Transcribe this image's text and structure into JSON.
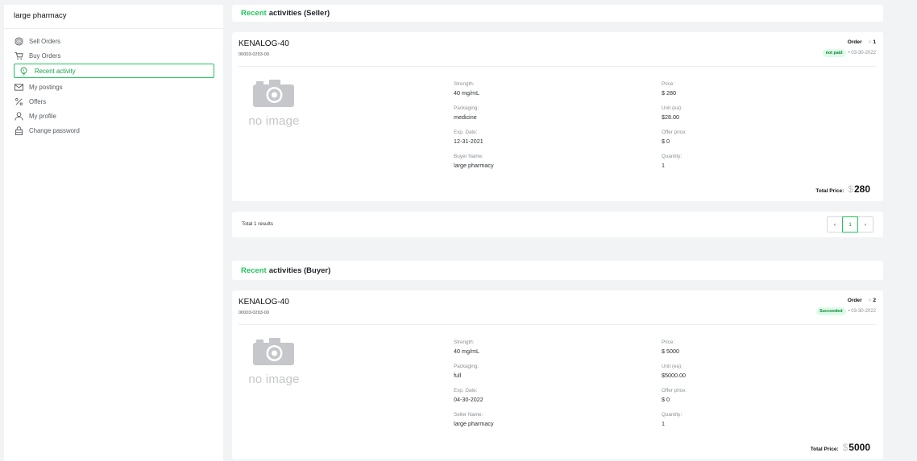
{
  "sidebar": {
    "title": "large pharmacy",
    "items": [
      {
        "label": "Sell Orders",
        "icon": "dollar-circle-icon"
      },
      {
        "label": "Buy Orders",
        "icon": "cart-icon"
      },
      {
        "label": "Recent activity",
        "icon": "lightbulb-icon",
        "active": true
      },
      {
        "label": "My postings",
        "icon": "mail-icon"
      },
      {
        "label": "Offers",
        "icon": "percent-icon"
      },
      {
        "label": "My profile",
        "icon": "user-icon"
      },
      {
        "label": "Change password",
        "icon": "lock-icon"
      }
    ]
  },
  "seller_section": {
    "title_highlight": "Recent",
    "title_rest": "activities (Seller)",
    "card": {
      "name": "KENALOG-40",
      "ndc": "00003-0293-00",
      "order_label": "Order",
      "order_hash": "#",
      "order_number": "1",
      "status": "not paid",
      "date": "• 03-30-2022",
      "no_image": "no image",
      "fields_left": [
        {
          "label": "Strength:",
          "value": "40 mg/mL"
        },
        {
          "label": "Packaging:",
          "value": "medicine"
        },
        {
          "label": "Exp. Date:",
          "value": "12-31-2021"
        },
        {
          "label": "Buyer Name:",
          "value": "large pharmacy"
        }
      ],
      "fields_right": [
        {
          "label": "Price:",
          "value": "$ 280"
        },
        {
          "label": "Unit (ea):",
          "value": "$28.00"
        },
        {
          "label": "Offer price:",
          "value": "$ 0"
        },
        {
          "label": "Quantity:",
          "value": "1"
        }
      ],
      "total_label": "Total Price:",
      "total_currency": "$",
      "total_amount": "280"
    },
    "pager": {
      "results_text": "Total 1 results",
      "prev": "‹",
      "page": "1",
      "next": "›"
    }
  },
  "buyer_section": {
    "title_highlight": "Recent",
    "title_rest": "activities (Buyer)",
    "card": {
      "name": "KENALOG-40",
      "ndc": "00003-0293-00",
      "order_label": "Order",
      "order_hash": "#",
      "order_number": "2",
      "status": "Succeeded",
      "date": "• 03-30-2022",
      "no_image": "no image",
      "fields_left": [
        {
          "label": "Strength:",
          "value": "40 mg/mL"
        },
        {
          "label": "Packaging:",
          "value": "full"
        },
        {
          "label": "Exp. Date:",
          "value": "04-30-2022"
        },
        {
          "label": "Seller Name:",
          "value": "large pharmacy"
        }
      ],
      "fields_right": [
        {
          "label": "Price:",
          "value": "$ 5000"
        },
        {
          "label": "Unit (ea):",
          "value": "$5000.00"
        },
        {
          "label": "Offer price:",
          "value": "$ 0"
        },
        {
          "label": "Quantity:",
          "value": "1"
        }
      ],
      "total_label": "Total Price:",
      "total_currency": "$",
      "total_amount": "5000"
    }
  },
  "colors": {
    "accent": "#22c55e",
    "badge_bg": "#dcfce7",
    "badge_text": "#15803d",
    "page_bg": "#f2f3f4"
  }
}
